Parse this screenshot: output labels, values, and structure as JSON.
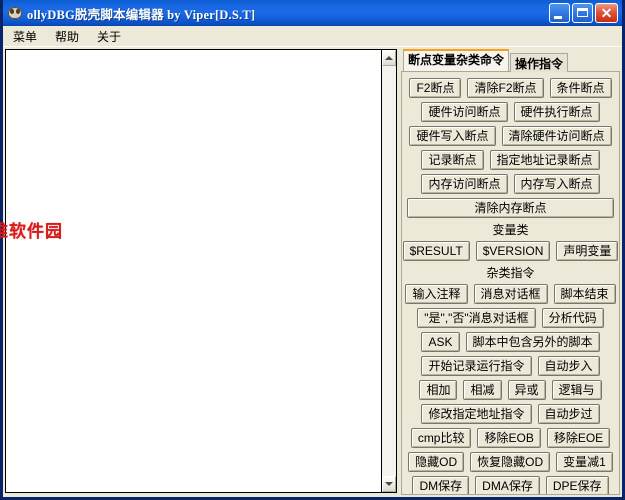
{
  "window": {
    "title": "ollyDBG脱壳脚本编辑器 by Viper[D.S.T]",
    "icon": "bug-icon",
    "minimize_label": "",
    "maximize_label": "",
    "close_label": "✕",
    "accent_titlebar": "#1866e0",
    "close_button_color": "#c32d16",
    "frame_color": "#0a246a",
    "face_color": "#ece9d8"
  },
  "menubar": {
    "items": [
      {
        "label": "菜单",
        "name": "menu-item-main"
      },
      {
        "label": "帮助",
        "name": "menu-item-help"
      },
      {
        "label": "关于",
        "name": "menu-item-about"
      }
    ]
  },
  "editor": {
    "content": "",
    "placeholder": "",
    "scrollbar": {
      "up_arrow": "▲",
      "down_arrow": "▼"
    }
  },
  "panel": {
    "tabs": [
      {
        "label": "断点变量杂类命令",
        "active": true,
        "name": "tab-breakpoint-variable-misc"
      },
      {
        "label": "操作指令",
        "active": false,
        "name": "tab-operation-commands"
      }
    ],
    "rows": [
      {
        "type": "buttons",
        "items": [
          {
            "label": "F2断点",
            "name": "btn-f2-breakpoint"
          },
          {
            "label": "清除F2断点",
            "name": "btn-clear-f2-breakpoint"
          },
          {
            "label": "条件断点",
            "name": "btn-conditional-breakpoint"
          }
        ]
      },
      {
        "type": "buttons",
        "items": [
          {
            "label": "硬件访问断点",
            "name": "btn-hardware-access-breakpoint"
          },
          {
            "label": "硬件执行断点",
            "name": "btn-hardware-execute-breakpoint"
          }
        ]
      },
      {
        "type": "buttons",
        "items": [
          {
            "label": "硬件写入断点",
            "name": "btn-hardware-write-breakpoint"
          },
          {
            "label": "清除硬件访问断点",
            "name": "btn-clear-hardware-access-breakpoint"
          }
        ]
      },
      {
        "type": "buttons",
        "items": [
          {
            "label": "记录断点",
            "name": "btn-log-breakpoint"
          },
          {
            "label": "指定地址记录断点",
            "name": "btn-log-breakpoint-at-address"
          }
        ]
      },
      {
        "type": "buttons",
        "items": [
          {
            "label": "内存访问断点",
            "name": "btn-memory-access-breakpoint"
          },
          {
            "label": "内存写入断点",
            "name": "btn-memory-write-breakpoint"
          }
        ]
      },
      {
        "type": "buttons",
        "items": [
          {
            "label": "清除内存断点",
            "name": "btn-clear-memory-breakpoint",
            "full": true
          }
        ]
      },
      {
        "type": "label",
        "label": "变量类",
        "name": "section-label-variables"
      },
      {
        "type": "buttons",
        "items": [
          {
            "label": "$RESULT",
            "name": "btn-result-variable"
          },
          {
            "label": "$VERSION",
            "name": "btn-version-variable"
          },
          {
            "label": "声明变量",
            "name": "btn-declare-variable"
          }
        ]
      },
      {
        "type": "label",
        "label": "杂类指令",
        "name": "section-label-misc-commands"
      },
      {
        "type": "buttons",
        "items": [
          {
            "label": "输入注释",
            "name": "btn-input-comment"
          },
          {
            "label": "消息对话框",
            "name": "btn-message-dialog"
          },
          {
            "label": "脚本结束",
            "name": "btn-script-end"
          }
        ]
      },
      {
        "type": "buttons",
        "items": [
          {
            "label": "\"是\",\"否\"消息对话框",
            "name": "btn-yes-no-message-dialog"
          },
          {
            "label": "分析代码",
            "name": "btn-analyze-code"
          }
        ]
      },
      {
        "type": "buttons",
        "items": [
          {
            "label": "ASK",
            "name": "btn-ask"
          },
          {
            "label": "脚本中包含另外的脚本",
            "name": "btn-include-another-script"
          }
        ]
      },
      {
        "type": "buttons",
        "items": [
          {
            "label": "开始记录运行指令",
            "name": "btn-start-logging-instructions"
          },
          {
            "label": "自动步入",
            "name": "btn-auto-step-into"
          }
        ]
      },
      {
        "type": "buttons",
        "items": [
          {
            "label": "相加",
            "name": "btn-add"
          },
          {
            "label": "相减",
            "name": "btn-subtract"
          },
          {
            "label": "异或",
            "name": "btn-xor"
          },
          {
            "label": "逻辑与",
            "name": "btn-logical-and"
          }
        ]
      },
      {
        "type": "buttons",
        "items": [
          {
            "label": "修改指定地址指令",
            "name": "btn-modify-instruction-at-address"
          },
          {
            "label": "自动步过",
            "name": "btn-auto-step-over"
          }
        ]
      },
      {
        "type": "buttons",
        "items": [
          {
            "label": "cmp比较",
            "name": "btn-cmp-compare"
          },
          {
            "label": "移除EOB",
            "name": "btn-remove-eob"
          },
          {
            "label": "移除EOE",
            "name": "btn-remove-eoe"
          }
        ]
      },
      {
        "type": "buttons",
        "items": [
          {
            "label": "隐藏OD",
            "name": "btn-hide-od"
          },
          {
            "label": "恢复隐藏OD",
            "name": "btn-restore-hidden-od"
          },
          {
            "label": "变量减1",
            "name": "btn-decrement-variable"
          }
        ]
      },
      {
        "type": "buttons",
        "items": [
          {
            "label": "DM保存",
            "name": "btn-dm-save"
          },
          {
            "label": "DMA保存",
            "name": "btn-dma-save"
          },
          {
            "label": "DPE保存",
            "name": "btn-dpe-save"
          }
        ]
      }
    ]
  },
  "watermark": {
    "text": "维维软件园",
    "color": "#d81b1b"
  }
}
